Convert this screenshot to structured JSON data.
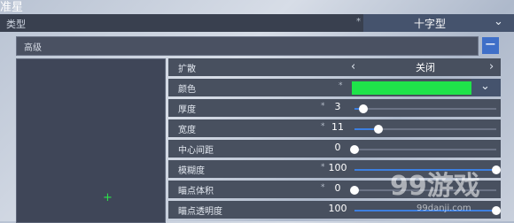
{
  "title": "准星",
  "type_row": {
    "label": "类型",
    "star": "*",
    "value": "十字型"
  },
  "advanced": {
    "label": "高级",
    "collapse_symbol": "−"
  },
  "preview": {
    "crosshair_color": "#2be34a"
  },
  "rows": [
    {
      "label": "扩散",
      "value": "关闭",
      "prev": "‹",
      "next": "›"
    },
    {
      "label": "颜色",
      "star": "*",
      "color": "#1fe34a"
    },
    {
      "label": "厚度",
      "star": "*",
      "value": "3",
      "ratio": 0.06
    },
    {
      "label": "宽度",
      "star": "*",
      "value": "11",
      "ratio": 0.17
    },
    {
      "label": "中心间距",
      "value": "0",
      "ratio": 0.0
    },
    {
      "label": "模糊度",
      "star": "*",
      "value": "100",
      "ratio": 1.0
    },
    {
      "label": "瞄点体积",
      "star": "*",
      "value": "0",
      "ratio": 0.0
    },
    {
      "label": "瞄点透明度",
      "value": "100",
      "ratio": 1.0
    }
  ],
  "watermark": {
    "text": "99游戏",
    "sub": "99danji.com"
  },
  "colors": {
    "accent": "#3d7fe0",
    "panel": "#48505f"
  }
}
